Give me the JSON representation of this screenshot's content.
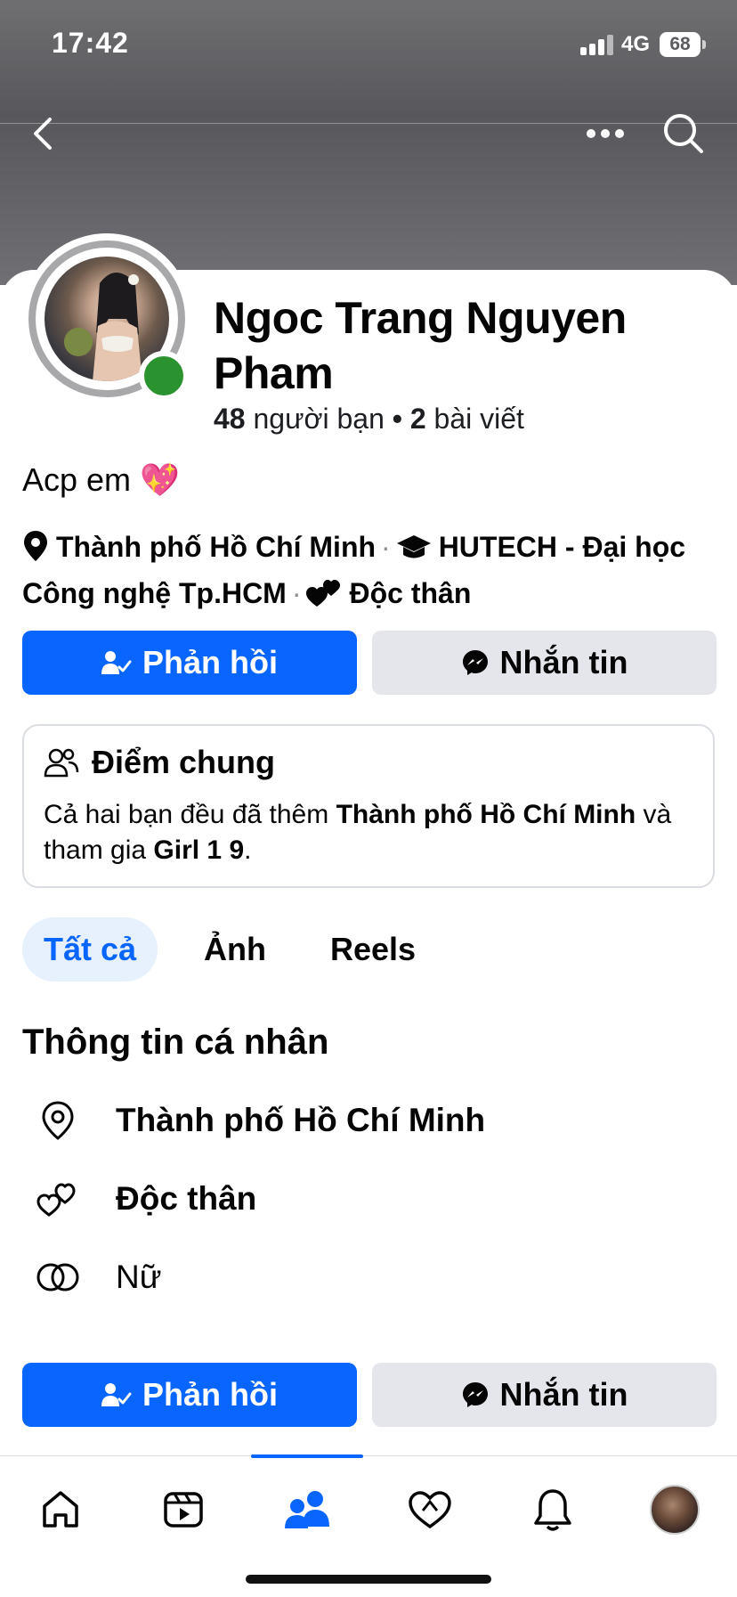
{
  "status_bar": {
    "time": "17:42",
    "network": "4G",
    "battery": "68"
  },
  "profile": {
    "name": "Ngoc Trang Nguyen Pham",
    "friends_count": "48",
    "friends_label": "người bạn",
    "stats_separator": "•",
    "posts_count": "2",
    "posts_label": "bài viết",
    "bio": "Acp em",
    "bio_emoji": "💖"
  },
  "details": {
    "location": "Thành phố Hồ Chí Minh",
    "education": "HUTECH - Đại học Công nghệ Tp.HCM",
    "relationship": "Độc thân",
    "separator": "·"
  },
  "actions": {
    "respond_label": "Phản hồi",
    "message_label": "Nhắn tin"
  },
  "common": {
    "title": "Điểm chung",
    "text_1": "Cả hai bạn đều đã thêm ",
    "place": "Thành phố Hồ Chí Minh",
    "text_2": " và tham gia ",
    "group": "Girl 1 9",
    "text_3": "."
  },
  "tabs": [
    {
      "label": "Tất cả",
      "active": true
    },
    {
      "label": "Ảnh",
      "active": false
    },
    {
      "label": "Reels",
      "active": false
    }
  ],
  "personal_info": {
    "title": "Thông tin cá nhân",
    "location": "Thành phố Hồ Chí Minh",
    "relationship": "Độc thân",
    "gender": "Nữ"
  },
  "bottom_nav": {
    "active": "friends"
  },
  "colors": {
    "primary": "#0866ff",
    "secondary_bg": "#e4e6eb",
    "online": "#2b9230"
  }
}
